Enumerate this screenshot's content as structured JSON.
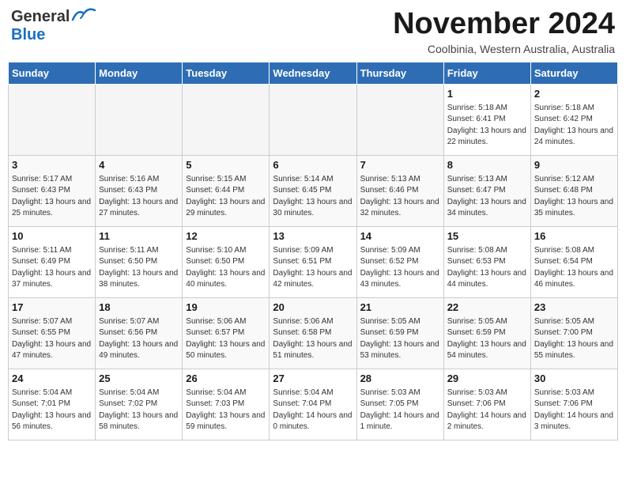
{
  "header": {
    "logo": {
      "general": "General",
      "blue": "Blue"
    },
    "month": "November 2024",
    "location": "Coolbinia, Western Australia, Australia"
  },
  "days_of_week": [
    "Sunday",
    "Monday",
    "Tuesday",
    "Wednesday",
    "Thursday",
    "Friday",
    "Saturday"
  ],
  "weeks": [
    [
      {
        "day": null
      },
      {
        "day": null
      },
      {
        "day": null
      },
      {
        "day": null
      },
      {
        "day": null
      },
      {
        "day": "1",
        "sunrise": "5:18 AM",
        "sunset": "6:41 PM",
        "daylight": "13 hours and 22 minutes."
      },
      {
        "day": "2",
        "sunrise": "5:18 AM",
        "sunset": "6:42 PM",
        "daylight": "13 hours and 24 minutes."
      }
    ],
    [
      {
        "day": "3",
        "sunrise": "5:17 AM",
        "sunset": "6:43 PM",
        "daylight": "13 hours and 25 minutes."
      },
      {
        "day": "4",
        "sunrise": "5:16 AM",
        "sunset": "6:43 PM",
        "daylight": "13 hours and 27 minutes."
      },
      {
        "day": "5",
        "sunrise": "5:15 AM",
        "sunset": "6:44 PM",
        "daylight": "13 hours and 29 minutes."
      },
      {
        "day": "6",
        "sunrise": "5:14 AM",
        "sunset": "6:45 PM",
        "daylight": "13 hours and 30 minutes."
      },
      {
        "day": "7",
        "sunrise": "5:13 AM",
        "sunset": "6:46 PM",
        "daylight": "13 hours and 32 minutes."
      },
      {
        "day": "8",
        "sunrise": "5:13 AM",
        "sunset": "6:47 PM",
        "daylight": "13 hours and 34 minutes."
      },
      {
        "day": "9",
        "sunrise": "5:12 AM",
        "sunset": "6:48 PM",
        "daylight": "13 hours and 35 minutes."
      }
    ],
    [
      {
        "day": "10",
        "sunrise": "5:11 AM",
        "sunset": "6:49 PM",
        "daylight": "13 hours and 37 minutes."
      },
      {
        "day": "11",
        "sunrise": "5:11 AM",
        "sunset": "6:50 PM",
        "daylight": "13 hours and 38 minutes."
      },
      {
        "day": "12",
        "sunrise": "5:10 AM",
        "sunset": "6:50 PM",
        "daylight": "13 hours and 40 minutes."
      },
      {
        "day": "13",
        "sunrise": "5:09 AM",
        "sunset": "6:51 PM",
        "daylight": "13 hours and 42 minutes."
      },
      {
        "day": "14",
        "sunrise": "5:09 AM",
        "sunset": "6:52 PM",
        "daylight": "13 hours and 43 minutes."
      },
      {
        "day": "15",
        "sunrise": "5:08 AM",
        "sunset": "6:53 PM",
        "daylight": "13 hours and 44 minutes."
      },
      {
        "day": "16",
        "sunrise": "5:08 AM",
        "sunset": "6:54 PM",
        "daylight": "13 hours and 46 minutes."
      }
    ],
    [
      {
        "day": "17",
        "sunrise": "5:07 AM",
        "sunset": "6:55 PM",
        "daylight": "13 hours and 47 minutes."
      },
      {
        "day": "18",
        "sunrise": "5:07 AM",
        "sunset": "6:56 PM",
        "daylight": "13 hours and 49 minutes."
      },
      {
        "day": "19",
        "sunrise": "5:06 AM",
        "sunset": "6:57 PM",
        "daylight": "13 hours and 50 minutes."
      },
      {
        "day": "20",
        "sunrise": "5:06 AM",
        "sunset": "6:58 PM",
        "daylight": "13 hours and 51 minutes."
      },
      {
        "day": "21",
        "sunrise": "5:05 AM",
        "sunset": "6:59 PM",
        "daylight": "13 hours and 53 minutes."
      },
      {
        "day": "22",
        "sunrise": "5:05 AM",
        "sunset": "6:59 PM",
        "daylight": "13 hours and 54 minutes."
      },
      {
        "day": "23",
        "sunrise": "5:05 AM",
        "sunset": "7:00 PM",
        "daylight": "13 hours and 55 minutes."
      }
    ],
    [
      {
        "day": "24",
        "sunrise": "5:04 AM",
        "sunset": "7:01 PM",
        "daylight": "13 hours and 56 minutes."
      },
      {
        "day": "25",
        "sunrise": "5:04 AM",
        "sunset": "7:02 PM",
        "daylight": "13 hours and 58 minutes."
      },
      {
        "day": "26",
        "sunrise": "5:04 AM",
        "sunset": "7:03 PM",
        "daylight": "13 hours and 59 minutes."
      },
      {
        "day": "27",
        "sunrise": "5:04 AM",
        "sunset": "7:04 PM",
        "daylight": "14 hours and 0 minutes."
      },
      {
        "day": "28",
        "sunrise": "5:03 AM",
        "sunset": "7:05 PM",
        "daylight": "14 hours and 1 minute."
      },
      {
        "day": "29",
        "sunrise": "5:03 AM",
        "sunset": "7:06 PM",
        "daylight": "14 hours and 2 minutes."
      },
      {
        "day": "30",
        "sunrise": "5:03 AM",
        "sunset": "7:06 PM",
        "daylight": "14 hours and 3 minutes."
      }
    ]
  ]
}
